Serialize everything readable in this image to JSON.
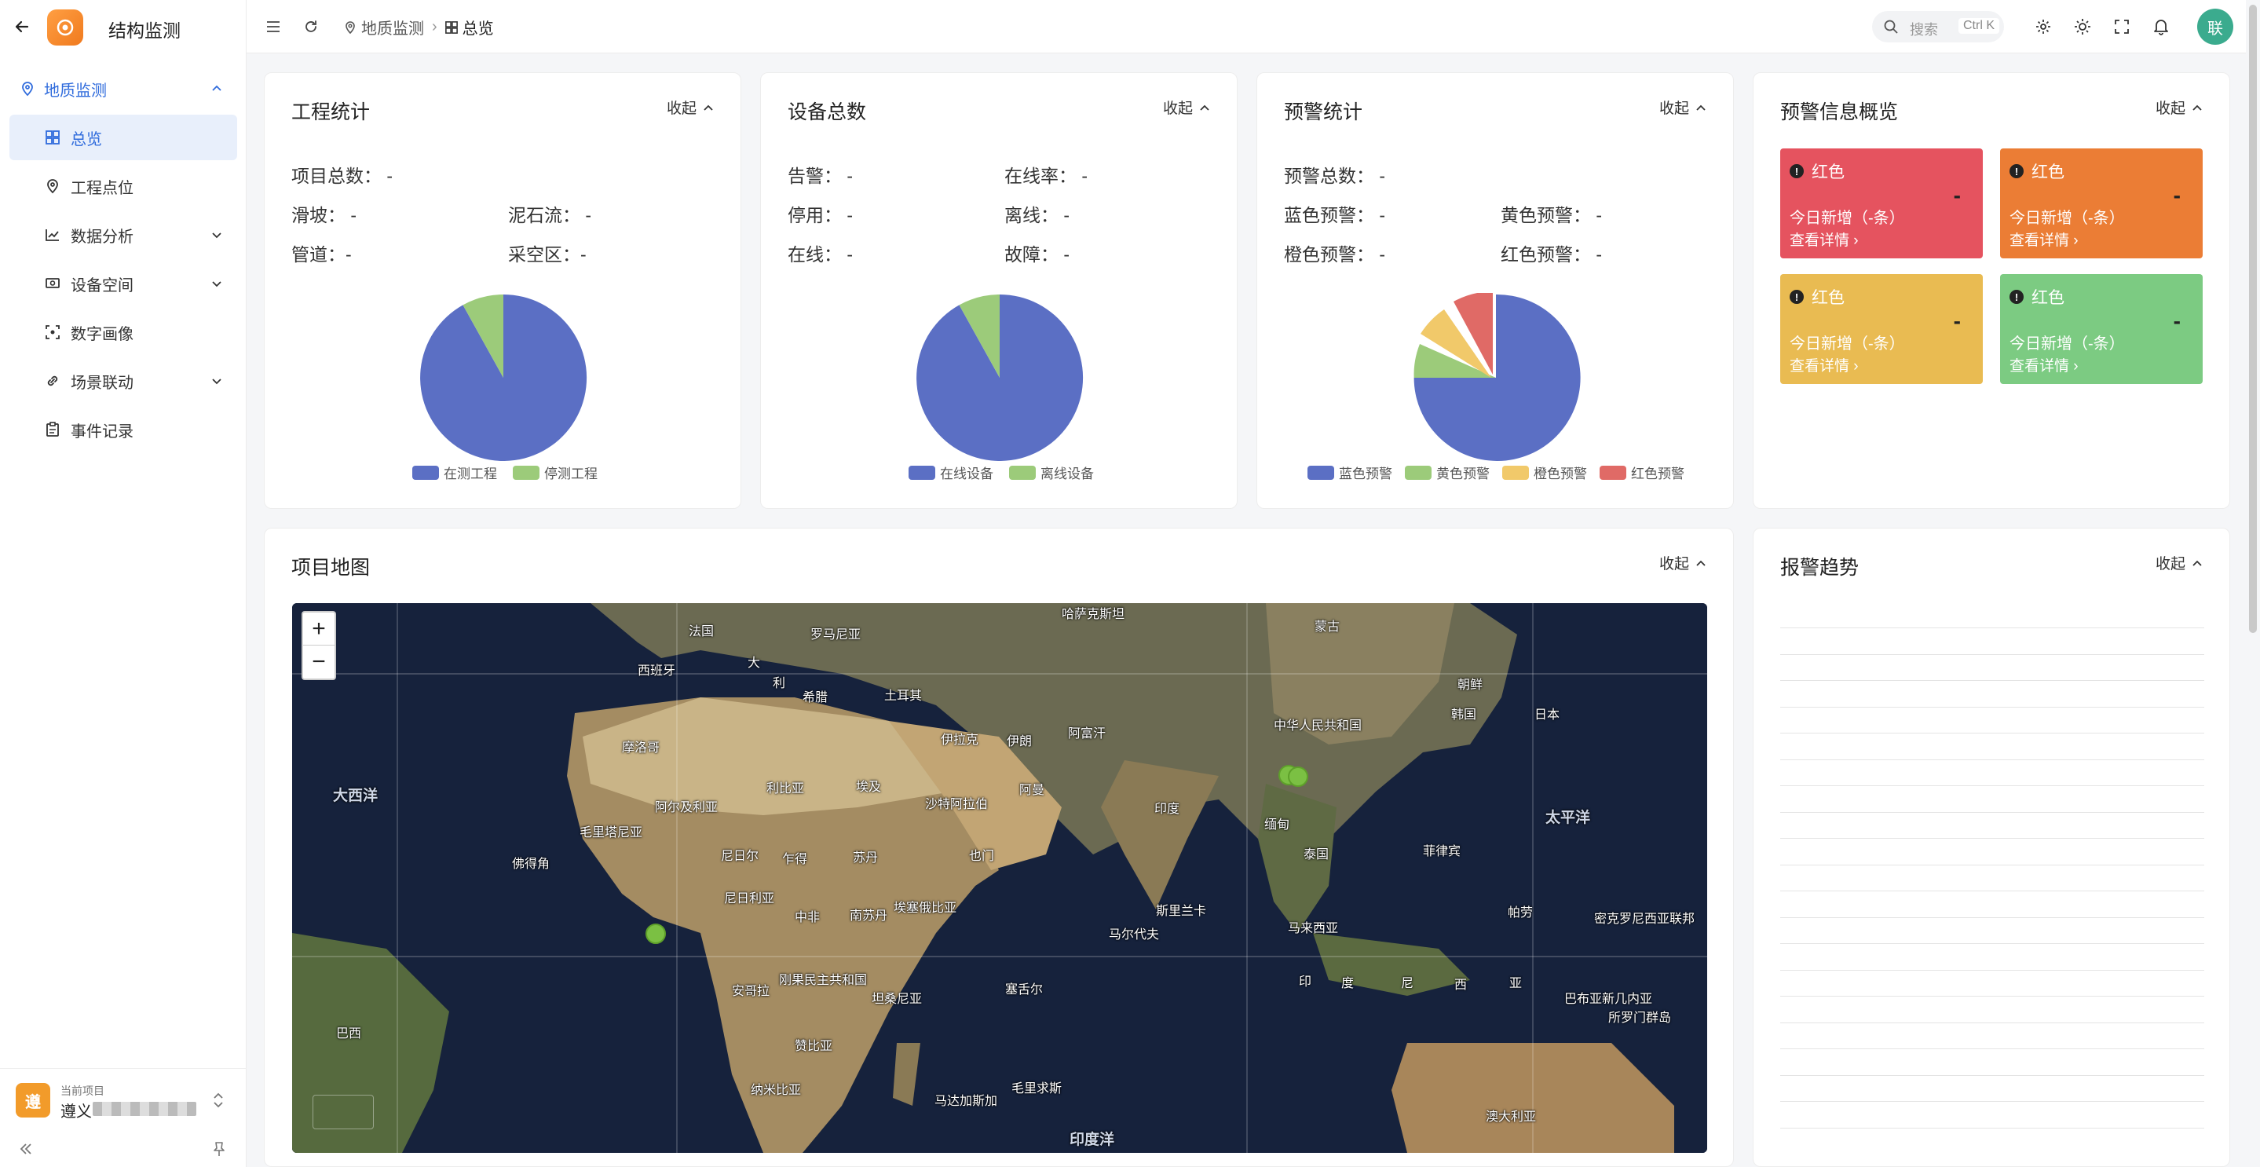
{
  "app": {
    "title": "结构监测"
  },
  "sidebar": {
    "group": {
      "label": "地质监测"
    },
    "items": [
      {
        "label": "总览",
        "icon": "dashboard-icon",
        "active": true
      },
      {
        "label": "工程点位",
        "icon": "map-pin-icon"
      },
      {
        "label": "数据分析",
        "icon": "line-chart-icon",
        "expandable": true
      },
      {
        "label": "设备空间",
        "icon": "device-icon",
        "expandable": true
      },
      {
        "label": "数字画像",
        "icon": "scan-icon"
      },
      {
        "label": "场景联动",
        "icon": "link-icon",
        "expandable": true
      },
      {
        "label": "事件记录",
        "icon": "clipboard-icon"
      }
    ],
    "project": {
      "caption": "当前项目",
      "name": "遵义",
      "avatar": "遵"
    }
  },
  "header": {
    "breadcrumb": [
      "地质监测",
      "总览"
    ],
    "search": {
      "placeholder": "搜索",
      "shortcut": "Ctrl K"
    },
    "avatar": "联"
  },
  "cards": {
    "collapse_label": "收起",
    "engineering": {
      "title": "工程统计",
      "stats": {
        "total": "项目总数：  -",
        "landslide": "滑坡：  -",
        "debris": "泥石流：  -",
        "pipeline": "管道：-",
        "goaf": "采空区：-"
      },
      "legend": [
        "在测工程",
        "停测工程"
      ]
    },
    "devices": {
      "title": "设备总数",
      "stats": {
        "alarm": "告警：  -",
        "online_rate": "在线率：  -",
        "disabled": "停用：  -",
        "offline": "离线：  -",
        "online": "在线：  -",
        "fault": "故障：  -"
      },
      "legend": [
        "在线设备",
        "离线设备"
      ]
    },
    "warnings": {
      "title": "预警统计",
      "stats": {
        "total": "预警总数：  -",
        "blue": "蓝色预警：  -",
        "yellow": "黄色预警：  -",
        "orange": "橙色预警：  -",
        "red": "红色预警：  -"
      },
      "legend": [
        "蓝色预警",
        "黄色预警",
        "橙色预警",
        "红色预警"
      ]
    },
    "overview": {
      "title": "预警信息概览",
      "tiles": [
        {
          "level": "红色",
          "count": "-",
          "new_text": "今日新增（-条）",
          "link": "查看详情 ›",
          "color": "#e5535f"
        },
        {
          "level": "红色",
          "count": "-",
          "new_text": "今日新增（-条）",
          "link": "查看详情 ›",
          "color": "#eb7d35"
        },
        {
          "level": "红色",
          "count": "-",
          "new_text": "今日新增（-条）",
          "link": "查看详情 ›",
          "color": "#e9bb52"
        },
        {
          "level": "红色",
          "count": "-",
          "new_text": "今日新增（-条）",
          "link": "查看详情 ›",
          "color": "#7ccb82"
        }
      ]
    },
    "map": {
      "title": "项目地图",
      "labels": [
        "法国",
        "罗马尼亚",
        "哈萨克斯坦",
        "蒙古",
        "西班牙",
        "大",
        "利",
        "希腊",
        "土耳其",
        "伊拉克",
        "伊朗",
        "阿富汗",
        "中华人民共和国",
        "朝鲜",
        "韩国",
        "日本",
        "摩洛哥",
        "阿尔及利亚",
        "利比亚",
        "埃及",
        "沙特阿拉伯",
        "阿曼",
        "印度",
        "缅甸",
        "泰国",
        "菲律宾",
        "毛里塔尼亚",
        "尼日尔",
        "乍得",
        "苏丹",
        "也门",
        "佛得角",
        "尼日利亚",
        "中非",
        "南苏丹",
        "埃塞俄比亚",
        "斯里兰卡",
        "马尔代夫",
        "马来西亚",
        "帕劳",
        "密克罗尼西亚联邦",
        "安哥拉",
        "刚果民主共和国",
        "坦桑尼亚",
        "塞舌尔",
        "印",
        "度",
        "尼",
        "西",
        "亚",
        "巴布亚新几内亚",
        "所罗门群岛",
        "巴西",
        "赞比亚",
        "纳米比亚",
        "马达加斯加",
        "毛里求斯",
        "澳大利亚",
        "大西洋",
        "太平洋",
        "印度洋"
      ]
    },
    "trend": {
      "title": "报警趋势"
    }
  },
  "colors": {
    "primary": "#2f6bdc",
    "pie_blue": "#5b6fc4",
    "pie_green": "#9ccb7a",
    "pie_yellow": "#f1c96a",
    "pie_red": "#e06a66"
  }
}
